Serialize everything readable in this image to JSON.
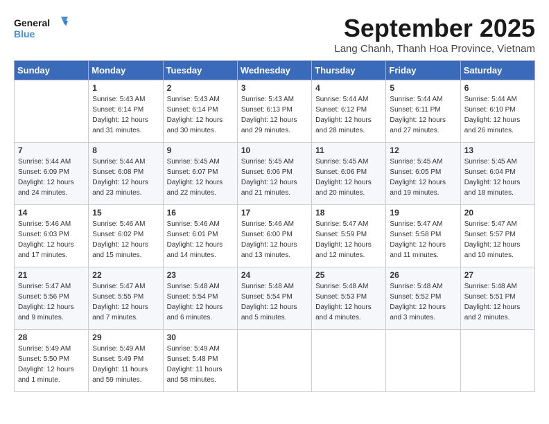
{
  "header": {
    "logo_line1": "General",
    "logo_line2": "Blue",
    "month": "September 2025",
    "location": "Lang Chanh, Thanh Hoa Province, Vietnam"
  },
  "weekdays": [
    "Sunday",
    "Monday",
    "Tuesday",
    "Wednesday",
    "Thursday",
    "Friday",
    "Saturday"
  ],
  "weeks": [
    [
      {
        "day": "",
        "sunrise": "",
        "sunset": "",
        "daylight": ""
      },
      {
        "day": "1",
        "sunrise": "Sunrise: 5:43 AM",
        "sunset": "Sunset: 6:14 PM",
        "daylight": "Daylight: 12 hours and 31 minutes."
      },
      {
        "day": "2",
        "sunrise": "Sunrise: 5:43 AM",
        "sunset": "Sunset: 6:14 PM",
        "daylight": "Daylight: 12 hours and 30 minutes."
      },
      {
        "day": "3",
        "sunrise": "Sunrise: 5:43 AM",
        "sunset": "Sunset: 6:13 PM",
        "daylight": "Daylight: 12 hours and 29 minutes."
      },
      {
        "day": "4",
        "sunrise": "Sunrise: 5:44 AM",
        "sunset": "Sunset: 6:12 PM",
        "daylight": "Daylight: 12 hours and 28 minutes."
      },
      {
        "day": "5",
        "sunrise": "Sunrise: 5:44 AM",
        "sunset": "Sunset: 6:11 PM",
        "daylight": "Daylight: 12 hours and 27 minutes."
      },
      {
        "day": "6",
        "sunrise": "Sunrise: 5:44 AM",
        "sunset": "Sunset: 6:10 PM",
        "daylight": "Daylight: 12 hours and 26 minutes."
      }
    ],
    [
      {
        "day": "7",
        "sunrise": "Sunrise: 5:44 AM",
        "sunset": "Sunset: 6:09 PM",
        "daylight": "Daylight: 12 hours and 24 minutes."
      },
      {
        "day": "8",
        "sunrise": "Sunrise: 5:44 AM",
        "sunset": "Sunset: 6:08 PM",
        "daylight": "Daylight: 12 hours and 23 minutes."
      },
      {
        "day": "9",
        "sunrise": "Sunrise: 5:45 AM",
        "sunset": "Sunset: 6:07 PM",
        "daylight": "Daylight: 12 hours and 22 minutes."
      },
      {
        "day": "10",
        "sunrise": "Sunrise: 5:45 AM",
        "sunset": "Sunset: 6:06 PM",
        "daylight": "Daylight: 12 hours and 21 minutes."
      },
      {
        "day": "11",
        "sunrise": "Sunrise: 5:45 AM",
        "sunset": "Sunset: 6:06 PM",
        "daylight": "Daylight: 12 hours and 20 minutes."
      },
      {
        "day": "12",
        "sunrise": "Sunrise: 5:45 AM",
        "sunset": "Sunset: 6:05 PM",
        "daylight": "Daylight: 12 hours and 19 minutes."
      },
      {
        "day": "13",
        "sunrise": "Sunrise: 5:45 AM",
        "sunset": "Sunset: 6:04 PM",
        "daylight": "Daylight: 12 hours and 18 minutes."
      }
    ],
    [
      {
        "day": "14",
        "sunrise": "Sunrise: 5:46 AM",
        "sunset": "Sunset: 6:03 PM",
        "daylight": "Daylight: 12 hours and 17 minutes."
      },
      {
        "day": "15",
        "sunrise": "Sunrise: 5:46 AM",
        "sunset": "Sunset: 6:02 PM",
        "daylight": "Daylight: 12 hours and 15 minutes."
      },
      {
        "day": "16",
        "sunrise": "Sunrise: 5:46 AM",
        "sunset": "Sunset: 6:01 PM",
        "daylight": "Daylight: 12 hours and 14 minutes."
      },
      {
        "day": "17",
        "sunrise": "Sunrise: 5:46 AM",
        "sunset": "Sunset: 6:00 PM",
        "daylight": "Daylight: 12 hours and 13 minutes."
      },
      {
        "day": "18",
        "sunrise": "Sunrise: 5:47 AM",
        "sunset": "Sunset: 5:59 PM",
        "daylight": "Daylight: 12 hours and 12 minutes."
      },
      {
        "day": "19",
        "sunrise": "Sunrise: 5:47 AM",
        "sunset": "Sunset: 5:58 PM",
        "daylight": "Daylight: 12 hours and 11 minutes."
      },
      {
        "day": "20",
        "sunrise": "Sunrise: 5:47 AM",
        "sunset": "Sunset: 5:57 PM",
        "daylight": "Daylight: 12 hours and 10 minutes."
      }
    ],
    [
      {
        "day": "21",
        "sunrise": "Sunrise: 5:47 AM",
        "sunset": "Sunset: 5:56 PM",
        "daylight": "Daylight: 12 hours and 9 minutes."
      },
      {
        "day": "22",
        "sunrise": "Sunrise: 5:47 AM",
        "sunset": "Sunset: 5:55 PM",
        "daylight": "Daylight: 12 hours and 7 minutes."
      },
      {
        "day": "23",
        "sunrise": "Sunrise: 5:48 AM",
        "sunset": "Sunset: 5:54 PM",
        "daylight": "Daylight: 12 hours and 6 minutes."
      },
      {
        "day": "24",
        "sunrise": "Sunrise: 5:48 AM",
        "sunset": "Sunset: 5:54 PM",
        "daylight": "Daylight: 12 hours and 5 minutes."
      },
      {
        "day": "25",
        "sunrise": "Sunrise: 5:48 AM",
        "sunset": "Sunset: 5:53 PM",
        "daylight": "Daylight: 12 hours and 4 minutes."
      },
      {
        "day": "26",
        "sunrise": "Sunrise: 5:48 AM",
        "sunset": "Sunset: 5:52 PM",
        "daylight": "Daylight: 12 hours and 3 minutes."
      },
      {
        "day": "27",
        "sunrise": "Sunrise: 5:48 AM",
        "sunset": "Sunset: 5:51 PM",
        "daylight": "Daylight: 12 hours and 2 minutes."
      }
    ],
    [
      {
        "day": "28",
        "sunrise": "Sunrise: 5:49 AM",
        "sunset": "Sunset: 5:50 PM",
        "daylight": "Daylight: 12 hours and 1 minute."
      },
      {
        "day": "29",
        "sunrise": "Sunrise: 5:49 AM",
        "sunset": "Sunset: 5:49 PM",
        "daylight": "Daylight: 11 hours and 59 minutes."
      },
      {
        "day": "30",
        "sunrise": "Sunrise: 5:49 AM",
        "sunset": "Sunset: 5:48 PM",
        "daylight": "Daylight: 11 hours and 58 minutes."
      },
      {
        "day": "",
        "sunrise": "",
        "sunset": "",
        "daylight": ""
      },
      {
        "day": "",
        "sunrise": "",
        "sunset": "",
        "daylight": ""
      },
      {
        "day": "",
        "sunrise": "",
        "sunset": "",
        "daylight": ""
      },
      {
        "day": "",
        "sunrise": "",
        "sunset": "",
        "daylight": ""
      }
    ]
  ]
}
